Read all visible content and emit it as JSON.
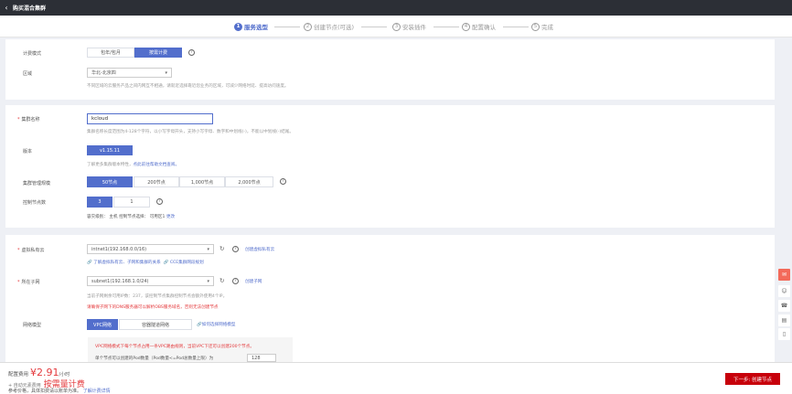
{
  "header": {
    "title": "购买混合集群"
  },
  "steps": [
    {
      "num": "1",
      "label": "服务选型"
    },
    {
      "num": "2",
      "label": "创建节点(可选)"
    },
    {
      "num": "3",
      "label": "安装插件"
    },
    {
      "num": "4",
      "label": "配置确认"
    },
    {
      "num": "5",
      "label": "完成"
    }
  ],
  "billing": {
    "label": "计费模式",
    "options": [
      "包年/包月",
      "按需计费"
    ],
    "selected": "按需计费"
  },
  "region": {
    "label": "区域",
    "value": "华北-北京四",
    "hint": "不同区域的云服务产品之间内网互不相通，请就近选择靠近您业务的区域，可减少网络时延、提高访问速度。"
  },
  "cluster_name": {
    "label": "集群名称",
    "value": "kcloud",
    "hint": "集群名称长度范围为4-128个字符，以小写字母开头，支持小写字母、数字和中划线(-)，不能以中划线(-)结尾。"
  },
  "version": {
    "label": "版本",
    "value": "v1.15.11",
    "hint_text": "了解更多集群版本特性，",
    "hint_link": "点此前往帮助文档查阅。"
  },
  "scale": {
    "label": "集群管理规模",
    "options": [
      "50节点",
      "200节点",
      "1,000节点",
      "2,000节点"
    ],
    "selected": "50节点"
  },
  "master": {
    "label": "控制节点数",
    "options": [
      "3",
      "1"
    ],
    "selected": "3",
    "hint_text": "容灾级别： 主机   控制节点选择： 可用区1 ",
    "hint_link": "更改"
  },
  "vpc": {
    "label": "虚拟私有云",
    "value": "intnet1(192.168.0.0/16)",
    "create_link": "创建虚拟私有云",
    "link1": "了解虚拟私有云、子网和集群的关系",
    "link2": "CCE集群网段规划"
  },
  "subnet": {
    "label": "所在子网",
    "value": "subnet1(192.168.1.0/24)",
    "create_link": "创建子网",
    "hint1": "当前子网剩余可用IP数：237，该控制节点集群控制节点会额外使用4个IP。",
    "hint2": "请确保子网下的DNS服务器可以解析OBS服务域名，否则无法创建节点"
  },
  "network_model": {
    "label": "网络模型",
    "options": [
      "VPC网络",
      "容器隧道网络"
    ],
    "selected": "VPC网络",
    "help_link": "如何选择网络模型",
    "warn1": "VPC网络模式下每个节点占用一条VPC路由规则，当前VPC下还可以创建200个节点。",
    "warn2": "单个节点可以创建的Pod数量（Pod数量<=Pod总数量上限）为",
    "pod_count": "128"
  },
  "footer": {
    "price_label": "配置费用",
    "price": "¥2.91",
    "price_unit": "/小时",
    "plus_label": "+ 自动元素费用",
    "plus_value": "按需量计费",
    "note": "参考价格，具体扣费请以账单为准。",
    "note_link": "了解计费详情",
    "next_button": "下一步: 创建节点"
  },
  "side_tools": [
    "chat-icon",
    "feedback-icon",
    "service-icon",
    "doc-icon"
  ]
}
